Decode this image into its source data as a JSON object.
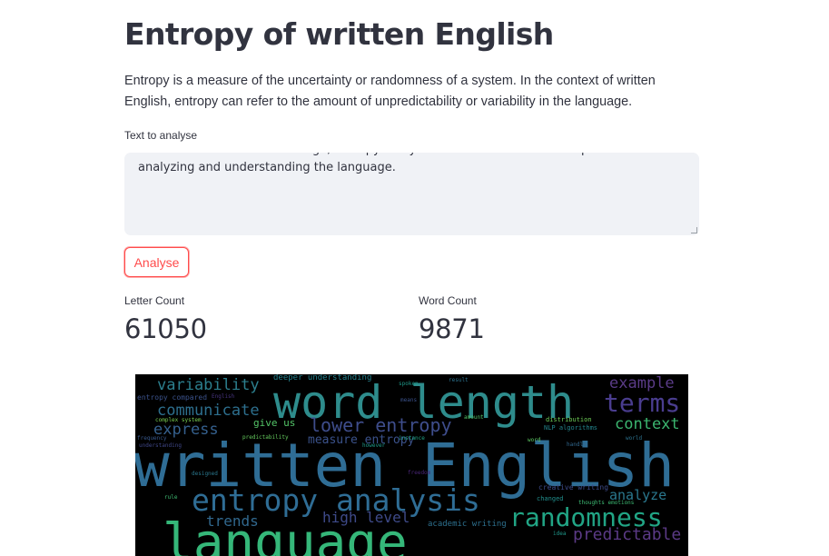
{
  "page": {
    "title": "Entropy of written English",
    "description": "Entropy is a measure of the uncertainty or randomness of a system. In the context of written English, entropy can refer to the amount of unpredictability or variability in the language."
  },
  "textarea": {
    "label": "Text to analyse",
    "value": "continues to evolve and change, entropy analysis will continue to be an important tool for analyzing and understanding the language."
  },
  "analyse_button": {
    "label": "Analyse"
  },
  "metrics": [
    {
      "label": "Letter Count",
      "value": "61050"
    },
    {
      "label": "Word Count",
      "value": "9871"
    }
  ],
  "wordcloud": {
    "background": "#000000",
    "words": [
      {
        "text": "word length",
        "color": "#2e8c8c"
      },
      {
        "text": "written English",
        "color": "#2f6d95"
      },
      {
        "text": "entropy analysis",
        "color": "#2f6d95"
      },
      {
        "text": "randomness",
        "color": "#21a585"
      },
      {
        "text": "terms",
        "color": "#4a3d8f"
      },
      {
        "text": "example",
        "color": "#5a3b87"
      },
      {
        "text": "context",
        "color": "#3bb56f"
      },
      {
        "text": "variability",
        "color": "#2c7f8e"
      },
      {
        "text": "communicate",
        "color": "#2d6f8e"
      },
      {
        "text": "express",
        "color": "#35608d"
      },
      {
        "text": "lower entropy",
        "color": "#3e4d8b"
      },
      {
        "text": "measure entropy",
        "color": "#3b528b"
      },
      {
        "text": "give us",
        "color": "#54c568"
      },
      {
        "text": "analyze",
        "color": "#2a788e"
      },
      {
        "text": "trends",
        "color": "#31688e"
      },
      {
        "text": "high level",
        "color": "#3e4a89"
      },
      {
        "text": "predictable",
        "color": "#5b3a86"
      },
      {
        "text": "deeper understanding",
        "color": "#26828e"
      },
      {
        "text": "entropy compared",
        "color": "#3b528b"
      },
      {
        "text": "academic writing",
        "color": "#2d708e"
      },
      {
        "text": "creative writing",
        "color": "#3e4c8a"
      },
      {
        "text": "NLP algorithms",
        "color": "#24868e"
      },
      {
        "text": "language",
        "color": "#35b779"
      },
      {
        "text": "English",
        "color": "#46337e"
      },
      {
        "text": "complex system",
        "color": "#7ad151"
      },
      {
        "text": "predictability",
        "color": "#65cb5e"
      },
      {
        "text": "understanding",
        "color": "#3f4788"
      },
      {
        "text": "designed",
        "color": "#2a788e"
      },
      {
        "text": "distribution",
        "color": "#6ece58"
      },
      {
        "text": "changed",
        "color": "#218f8d"
      },
      {
        "text": "thoughts emotions",
        "color": "#3dbc74"
      },
      {
        "text": "handle",
        "color": "#31688e"
      },
      {
        "text": "freedom",
        "color": "#482576"
      },
      {
        "text": "instance",
        "color": "#20a486"
      },
      {
        "text": "spoken",
        "color": "#1f9a8a"
      },
      {
        "text": "result",
        "color": "#2c728e"
      },
      {
        "text": "means",
        "color": "#3b528b"
      },
      {
        "text": "frequency",
        "color": "#38588c"
      },
      {
        "text": "word",
        "color": "#5ec962"
      },
      {
        "text": "world",
        "color": "#2c728e"
      },
      {
        "text": "however",
        "color": "#1e9b8a"
      },
      {
        "text": "amount",
        "color": "#52c569"
      },
      {
        "text": "rule",
        "color": "#3fbc73"
      },
      {
        "text": "idea",
        "color": "#1f988b"
      }
    ]
  }
}
